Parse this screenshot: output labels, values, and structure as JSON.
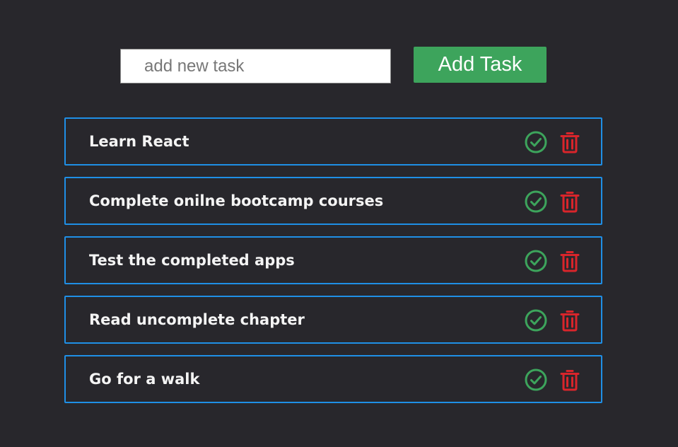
{
  "add_form": {
    "input_value": "",
    "input_placeholder": "add new task",
    "button_label": "Add Task"
  },
  "tasks": [
    {
      "label": "Learn React"
    },
    {
      "label": "Complete onilne bootcamp courses"
    },
    {
      "label": "Test the completed apps"
    },
    {
      "label": "Read uncomplete chapter"
    },
    {
      "label": "Go for a walk"
    }
  ],
  "icons": {
    "complete": "check-circle-icon",
    "delete": "trash-icon"
  },
  "colors": {
    "background": "#28272c",
    "task_border": "#1f8fe6",
    "add_button": "#3da45c",
    "check_icon": "#3da45c",
    "trash_icon": "#d9252b"
  }
}
